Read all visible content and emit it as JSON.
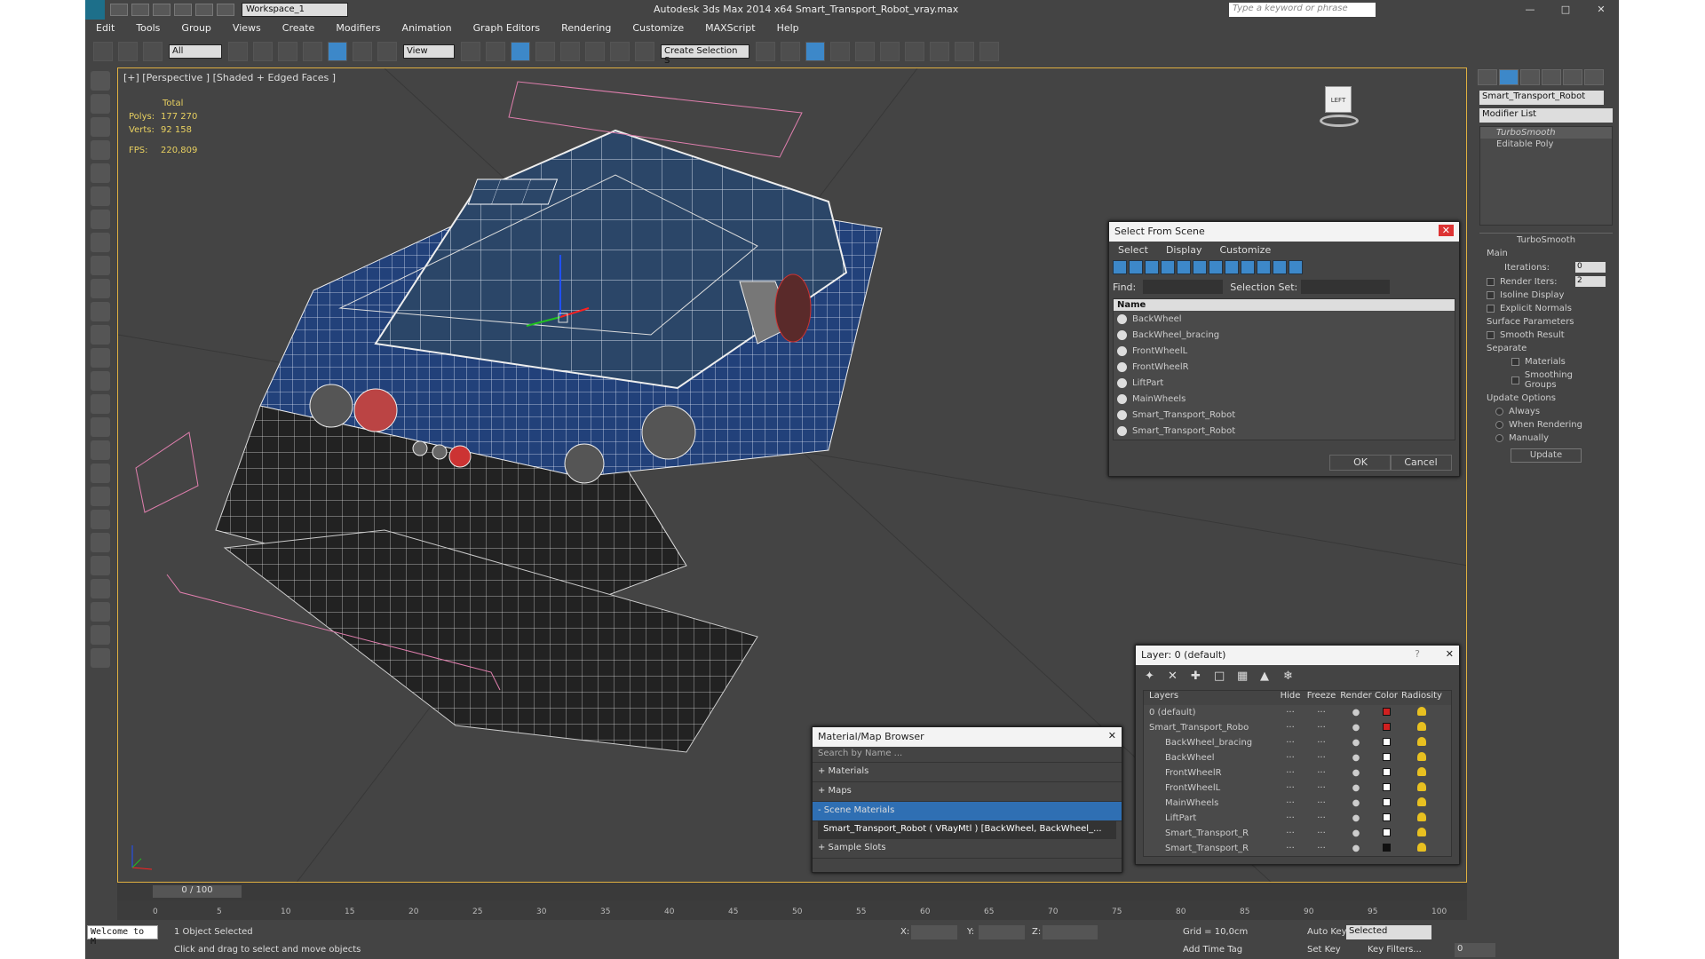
{
  "titlebar": {
    "workspace": "Workspace_1",
    "app_title": "Autodesk 3ds Max  2014 x64     Smart_Transport_Robot_vray.max",
    "search_placeholder": "Type a keyword or phrase"
  },
  "menu": [
    "Edit",
    "Tools",
    "Group",
    "Views",
    "Create",
    "Modifiers",
    "Animation",
    "Graph Editors",
    "Rendering",
    "Customize",
    "MAXScript",
    "Help"
  ],
  "toolbar": {
    "selection_filter": "All",
    "ref_coord": "View",
    "selection_set": "Create Selection S"
  },
  "viewport": {
    "label": "[+] [Perspective ] [Shaded + Edged Faces ]",
    "stats": {
      "total_label": "Total",
      "polys_label": "Polys:",
      "polys": "177 270",
      "verts_label": "Verts:",
      "verts": "92 158",
      "fps_label": "FPS:",
      "fps": "220,809"
    },
    "viewcube": "LEFT"
  },
  "command_panel": {
    "object_name": "Smart_Transport_Robot",
    "modifier_list": "Modifier List",
    "stack": [
      "TurboSmooth",
      "Editable Poly"
    ],
    "turbosmooth": {
      "title": "TurboSmooth",
      "main": "Main",
      "iterations_label": "Iterations:",
      "iterations": "0",
      "render_iters_label": "Render Iters:",
      "render_iters": "2",
      "isoline": "Isoline Display",
      "explicit_normals": "Explicit Normals",
      "surface_params": "Surface Parameters",
      "smooth_result": "Smooth Result",
      "separate": "Separate",
      "materials": "Materials",
      "smoothing_groups": "Smoothing Groups",
      "update_options": "Update Options",
      "always": "Always",
      "when_rendering": "When Rendering",
      "manually": "Manually",
      "update": "Update"
    }
  },
  "select_from_scene": {
    "title": "Select From Scene",
    "menu": [
      "Select",
      "Display",
      "Customize"
    ],
    "find_label": "Find:",
    "selection_set_label": "Selection Set:",
    "col_name": "Name",
    "items": [
      "BackWheel",
      "BackWheel_bracing",
      "FrontWheelL",
      "FrontWheelR",
      "LiftPart",
      "MainWheels",
      "Smart_Transport_Robot",
      "Smart_Transport_Robot"
    ],
    "ok": "OK",
    "cancel": "Cancel"
  },
  "material_browser": {
    "title": "Material/Map Browser",
    "search": "Search by Name ...",
    "sections": [
      "+ Materials",
      "+ Maps",
      "- Scene Materials"
    ],
    "scene_material": "Smart_Transport_Robot  ( VRayMtl )  [BackWheel, BackWheel_...",
    "sample_slots": "+ Sample Slots"
  },
  "layer_dialog": {
    "title": "Layer: 0 (default)",
    "question": "?",
    "headers": [
      "Layers",
      "Hide",
      "Freeze",
      "Render",
      "Color",
      "Radiosity"
    ],
    "rows": [
      {
        "name": "0 (default)",
        "color": "#d02020"
      },
      {
        "name": "Smart_Transport_Robo",
        "color": "#d02020"
      },
      {
        "name": "BackWheel_bracing",
        "color": "#ffffff"
      },
      {
        "name": "BackWheel",
        "color": "#ffffff"
      },
      {
        "name": "FrontWheelR",
        "color": "#ffffff"
      },
      {
        "name": "FrontWheelL",
        "color": "#ffffff"
      },
      {
        "name": "MainWheels",
        "color": "#ffffff"
      },
      {
        "name": "LiftPart",
        "color": "#ffffff"
      },
      {
        "name": "Smart_Transport_R",
        "color": "#ffffff"
      },
      {
        "name": "Smart_Transport_R",
        "color": "#111111"
      }
    ]
  },
  "timeline": {
    "frame": "0 / 100",
    "ticks": [
      "0",
      "5",
      "10",
      "15",
      "20",
      "25",
      "30",
      "35",
      "40",
      "45",
      "50",
      "55",
      "60",
      "65",
      "70",
      "75",
      "80",
      "85",
      "90",
      "95",
      "100"
    ]
  },
  "status": {
    "welcome": "Welcome to M",
    "selected": "1 Object Selected",
    "hint": "Click and drag to select and move objects",
    "x_label": "X:",
    "y_label": "Y:",
    "z_label": "Z:",
    "grid": "Grid = 10,0cm",
    "add_time_tag": "Add Time Tag",
    "auto_key": "Auto Key",
    "set_key": "Set Key",
    "key_mode": "Selected",
    "key_filters": "Key Filters...",
    "frame_field": "0"
  }
}
